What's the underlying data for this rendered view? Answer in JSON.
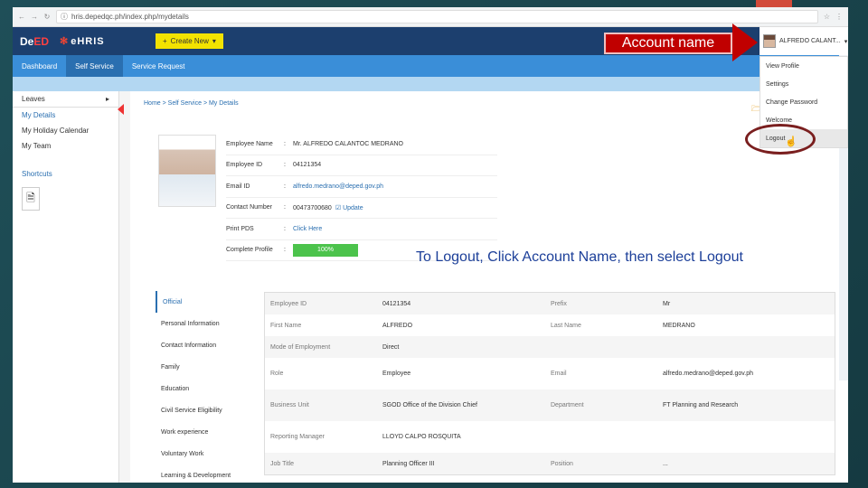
{
  "browser": {
    "url": "hris.depedqc.ph/index.php/mydetails"
  },
  "header": {
    "logo_deped_prefix": "De",
    "logo_deped_suffix": "ED",
    "logo_ehris": "eHRIS",
    "create_new": "Create New",
    "account_name": "ALFREDO CALANT..."
  },
  "menu": [
    "Dashboard",
    "Self Service",
    "Service Request"
  ],
  "sidebar": {
    "leaves": "Leaves",
    "items": [
      "My Details",
      "My Holiday Calendar",
      "My Team"
    ],
    "shortcuts": "Shortcuts"
  },
  "breadcrumb": "Home > Self Service > My Details",
  "profile": {
    "rows": [
      {
        "label": "Employee Name",
        "value": "Mr. ALFREDO CALANTOC MEDRANO"
      },
      {
        "label": "Employee ID",
        "value": "04121354"
      },
      {
        "label": "Email ID",
        "value": "alfredo.medrano@deped.gov.ph"
      },
      {
        "label": "Contact Number",
        "value": "00473700680",
        "action": "Update"
      },
      {
        "label": "Print PDS",
        "value": "Click Here"
      },
      {
        "label": "Complete Profile",
        "value": "100%"
      }
    ],
    "complete_fraction": 1.0
  },
  "tabs": [
    "Official",
    "Personal Information",
    "Contact Information",
    "Family",
    "Education",
    "Civil Service Eligibility",
    "Work experience",
    "Voluntary Work",
    "Learning & Development"
  ],
  "details": [
    [
      "Employee ID",
      "04121354",
      "Prefix",
      "Mr"
    ],
    [
      "First Name",
      "ALFREDO",
      "Last Name",
      "MEDRANO"
    ],
    [
      "Mode of Employment",
      "Direct",
      "",
      ""
    ],
    [
      "Role",
      "Employee",
      "Email",
      "alfredo.medrano@deped.gov.ph"
    ],
    [
      "Business Unit",
      "SGOD Office of the Division Chief",
      "Department",
      "FT Planning and Research"
    ],
    [
      "Reporting Manager",
      "LLOYD CALPO ROSQUITA",
      "",
      ""
    ],
    [
      "Job Title",
      "Planning Officer III",
      "Position",
      "..."
    ]
  ],
  "dropdown": [
    "View Profile",
    "Settings",
    "Change Password",
    "Welcome",
    "Logout"
  ],
  "annotations": {
    "box": "Account name",
    "instruction": "To Logout, Click Account Name, then select Logout"
  },
  "colors": {
    "annotation_red": "#c00000",
    "annotation_blue": "#1c3f99",
    "topbar": "#1c3f6e",
    "menubar": "#3a8ed8"
  }
}
